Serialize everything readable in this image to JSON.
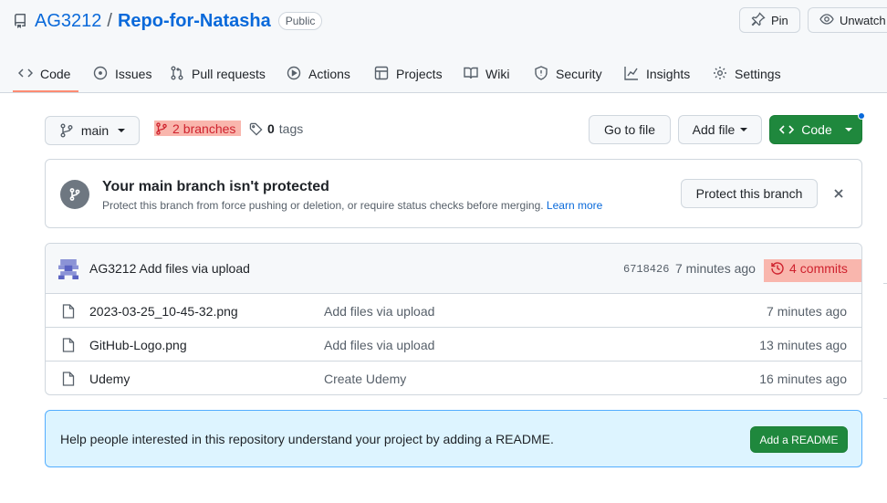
{
  "repo": {
    "owner": "AG3212",
    "separator": "/",
    "name": "Repo-for-Natasha",
    "visibility": "Public"
  },
  "top_buttons": {
    "pin": "Pin",
    "unwatch": "Unwatch"
  },
  "tabs": [
    {
      "label": "Code",
      "icon": "code-icon"
    },
    {
      "label": "Issues",
      "icon": "issue-icon"
    },
    {
      "label": "Pull requests",
      "icon": "pull-request-icon"
    },
    {
      "label": "Actions",
      "icon": "play-icon"
    },
    {
      "label": "Projects",
      "icon": "table-icon"
    },
    {
      "label": "Wiki",
      "icon": "book-icon"
    },
    {
      "label": "Security",
      "icon": "shield-icon"
    },
    {
      "label": "Insights",
      "icon": "graph-icon"
    },
    {
      "label": "Settings",
      "icon": "gear-icon"
    }
  ],
  "branch_bar": {
    "branch": "main",
    "branches_count": "2",
    "branches_label": "branches",
    "tags_count": "0",
    "tags_label": "tags",
    "go_to_file": "Go to file",
    "add_file": "Add file",
    "code": "Code"
  },
  "protect_banner": {
    "title": "Your main branch isn't protected",
    "description": "Protect this branch from force pushing or deletion, or require status checks before merging.",
    "learn_more": "Learn more",
    "button": "Protect this branch"
  },
  "latest_commit": {
    "author": "AG3212",
    "message": "Add files via upload",
    "sha": "6718426",
    "time": "7 minutes ago",
    "commits_count": "4",
    "commits_label": "commits"
  },
  "files": [
    {
      "name": "2023-03-25_10-45-32.png",
      "message": "Add files via upload",
      "time": "7 minutes ago"
    },
    {
      "name": "GitHub-Logo.png",
      "message": "Add files via upload",
      "time": "13 minutes ago"
    },
    {
      "name": "Udemy",
      "message": "Create Udemy",
      "time": "16 minutes ago"
    }
  ],
  "readme_banner": {
    "text": "Help people interested in this repository understand your project by adding a README.",
    "button": "Add a README"
  },
  "colors": {
    "accent": "#0969da",
    "green": "#1f883d",
    "highlight": "#f9b6ad",
    "readme_bg": "#ddf4ff"
  }
}
